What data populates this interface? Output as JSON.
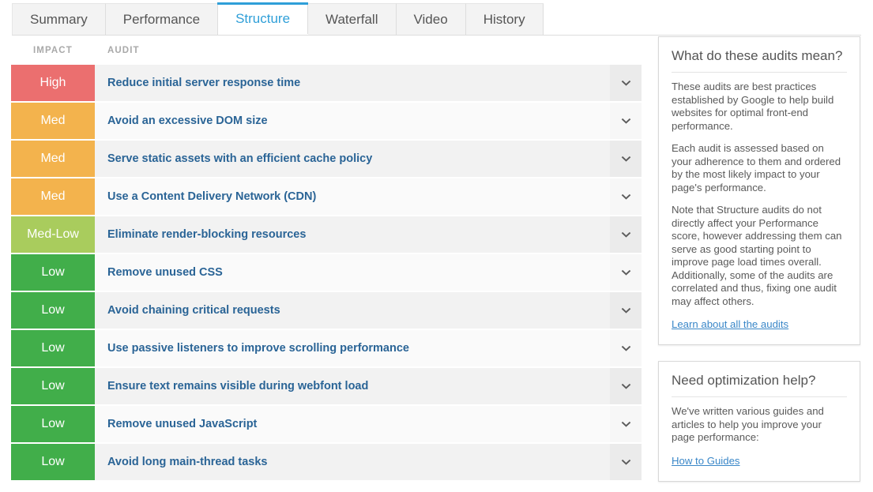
{
  "tabs": [
    {
      "label": "Summary",
      "active": false
    },
    {
      "label": "Performance",
      "active": false
    },
    {
      "label": "Structure",
      "active": true
    },
    {
      "label": "Waterfall",
      "active": false
    },
    {
      "label": "Video",
      "active": false
    },
    {
      "label": "History",
      "active": false
    }
  ],
  "table": {
    "headers": {
      "impact": "IMPACT",
      "audit": "AUDIT"
    },
    "expand_icon": "chevron-down-icon",
    "rows": [
      {
        "impact": "High",
        "impact_level": "high",
        "impact_color": "#eb6f6f",
        "audit": "Reduce initial server response time"
      },
      {
        "impact": "Med",
        "impact_level": "med",
        "impact_color": "#f3b34d",
        "audit": "Avoid an excessive DOM size"
      },
      {
        "impact": "Med",
        "impact_level": "med",
        "impact_color": "#f3b34d",
        "audit": "Serve static assets with an efficient cache policy"
      },
      {
        "impact": "Med",
        "impact_level": "med",
        "impact_color": "#f3b34d",
        "audit": "Use a Content Delivery Network (CDN)"
      },
      {
        "impact": "Med-Low",
        "impact_level": "medlow",
        "impact_color": "#a9cc5d",
        "audit": "Eliminate render-blocking resources"
      },
      {
        "impact": "Low",
        "impact_level": "low",
        "impact_color": "#41ae4a",
        "audit": "Remove unused CSS"
      },
      {
        "impact": "Low",
        "impact_level": "low",
        "impact_color": "#41ae4a",
        "audit": "Avoid chaining critical requests"
      },
      {
        "impact": "Low",
        "impact_level": "low",
        "impact_color": "#41ae4a",
        "audit": "Use passive listeners to improve scrolling performance"
      },
      {
        "impact": "Low",
        "impact_level": "low",
        "impact_color": "#41ae4a",
        "audit": "Ensure text remains visible during webfont load"
      },
      {
        "impact": "Low",
        "impact_level": "low",
        "impact_color": "#41ae4a",
        "audit": "Remove unused JavaScript"
      },
      {
        "impact": "Low",
        "impact_level": "low",
        "impact_color": "#41ae4a",
        "audit": "Avoid long main-thread tasks"
      }
    ]
  },
  "panels": [
    {
      "title": "What do these audits mean?",
      "paragraphs": [
        "These audits are best practices established by Google to help build websites for optimal front-end performance.",
        "Each audit is assessed based on your adherence to them and ordered by the most likely impact to your page's performance.",
        "Note that Structure audits do not directly affect your Performance score, however addressing them can serve as good starting point to improve page load times overall. Additionally, some of the audits are correlated and thus, fixing one audit may affect others."
      ],
      "link": "Learn about all the audits"
    },
    {
      "title": "Need optimization help?",
      "paragraphs": [
        "We've written various guides and articles to help you improve your page performance:"
      ],
      "link": "How to Guides"
    }
  ],
  "theme": {
    "accent": "#2f9fd8",
    "link": "#3a87c8",
    "audit_title": "#2a6496"
  }
}
